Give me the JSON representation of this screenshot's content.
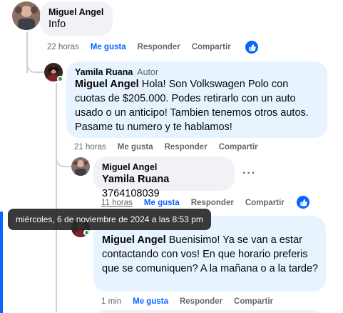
{
  "comments": [
    {
      "author": "Miguel Angel",
      "badge": "",
      "mention": "",
      "text": "Info",
      "time": "22 horas",
      "like": "Me gusta",
      "reply": "Responder",
      "share": "Compartir"
    },
    {
      "author": "Yamila Ruana",
      "badge": "Autor",
      "mention": "Miguel Angel",
      "text": " Hola! Son Volkswagen Polo con cuotas de $205.000. Podes retirarlo con un auto usado o un anticipo! Tambien tenemos otros autos. Pasame tu numero y te hablamos!",
      "time": "21 horas",
      "like": "Me gusta",
      "reply": "Responder",
      "share": "Compartir"
    },
    {
      "author": "Miguel Angel",
      "badge": "",
      "mention": "Yamila Ruana",
      "text": " 3764108039",
      "time": "11 horas",
      "like": "Me gusta",
      "reply": "Responder",
      "share": "Compartir"
    },
    {
      "author": "",
      "badge": "",
      "mention": "Miguel Angel",
      "text": " Buenisimo! Ya se van a estar contactando con vos! En que horario preferis que se comuniquen? A la mañana o a la tarde?",
      "time": "1 min",
      "like": "Me gusta",
      "reply": "Responder",
      "share": "Compartir"
    }
  ],
  "tooltip": "miércoles, 6 de noviembre de 2024 a las 8:53 pm",
  "more_options": "···",
  "icons": [
    "like-icon",
    "more-options-icon"
  ],
  "colors": {
    "accent": "#0866ff",
    "author_bubble": "#e7f3ff",
    "bubble": "#f0f2f5",
    "online": "#31a24c"
  }
}
